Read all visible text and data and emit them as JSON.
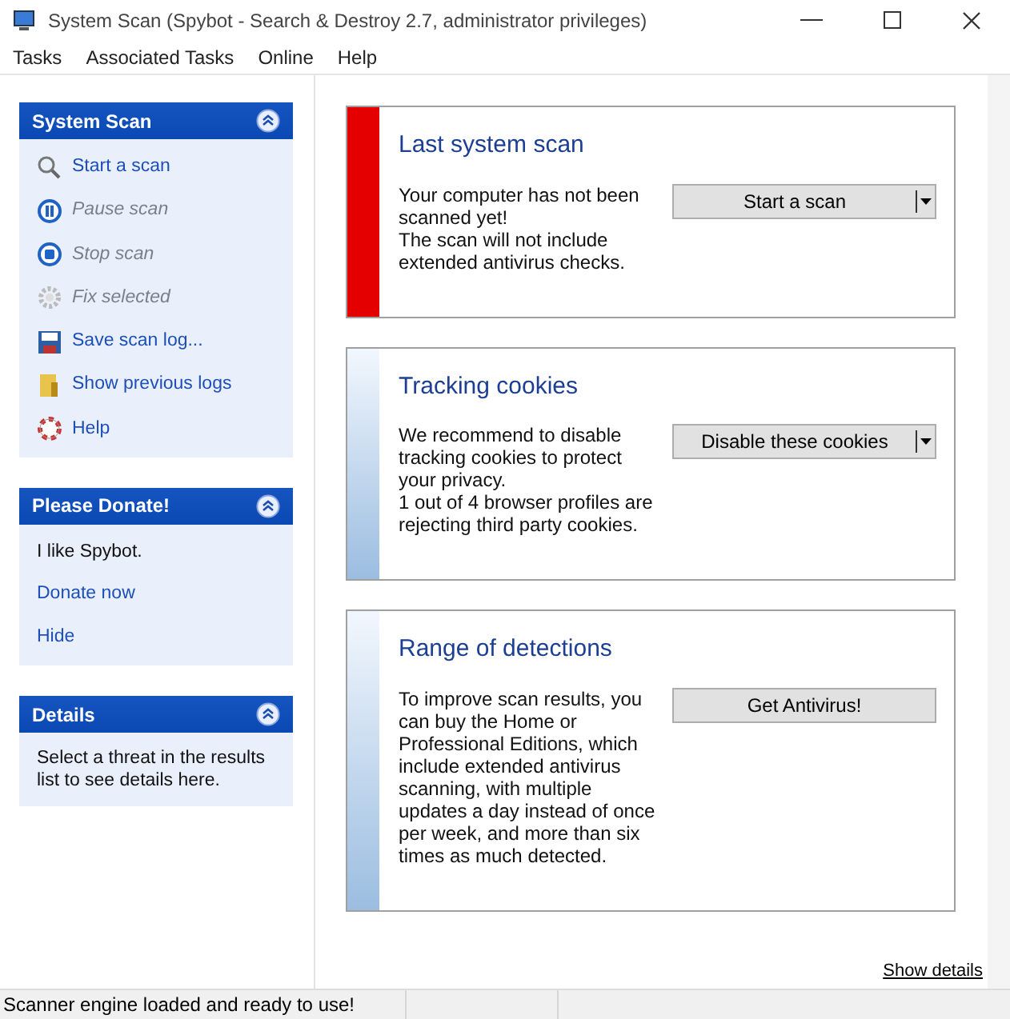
{
  "window": {
    "title": "System Scan (Spybot - Search & Destroy 2.7, administrator privileges)"
  },
  "menu": [
    "Tasks",
    "Associated Tasks",
    "Online",
    "Help"
  ],
  "panels": [
    {
      "title": "System Scan",
      "items": [
        {
          "kind": "task",
          "label": "Start a scan",
          "disabled": false
        },
        {
          "kind": "task",
          "label": "Pause scan",
          "disabled": true
        },
        {
          "kind": "task",
          "label": "Stop scan",
          "disabled": true
        },
        {
          "kind": "task",
          "label": "Fix selected",
          "disabled": true
        },
        {
          "kind": "task",
          "label": "Save scan log...",
          "disabled": false
        },
        {
          "kind": "task",
          "label": "Show previous logs",
          "disabled": false
        },
        {
          "kind": "task",
          "label": "Help",
          "disabled": false
        }
      ]
    },
    {
      "title": "Please Donate!",
      "items": [
        {
          "kind": "text",
          "label": "I like Spybot."
        },
        {
          "kind": "link",
          "label": "Donate now",
          "disabled": false
        },
        {
          "kind": "link",
          "label": "Hide",
          "disabled": false
        }
      ]
    },
    {
      "title": "Details",
      "items": [
        {
          "kind": "text",
          "label": "Select a threat in the results list to see details here."
        }
      ]
    }
  ],
  "cards": [
    {
      "kind": "alert",
      "title": "Last system scan",
      "lines": [
        "Your computer has not been scanned yet!",
        "The scan will not include extended antivirus checks."
      ],
      "button": "Start a scan",
      "has_menu": true
    },
    {
      "kind": "info",
      "title": "Tracking cookies",
      "lines": [
        "We recommend to disable tracking cookies to protect your privacy.",
        "1 out of 4 browser profiles are rejecting third party cookies."
      ],
      "button": "Disable these cookies",
      "has_menu": true
    },
    {
      "kind": "info",
      "title": "Range of detections",
      "lines": [
        "To improve scan results, you can buy the Home or Professional Editions, which include extended antivirus scanning, with multiple updates a day instead of once per week, and more than six times as much detected."
      ],
      "button": "Get Antivirus!",
      "has_menu": false
    }
  ],
  "details_link": "Show details",
  "status_bar": "Scanner engine loaded and ready to use!"
}
